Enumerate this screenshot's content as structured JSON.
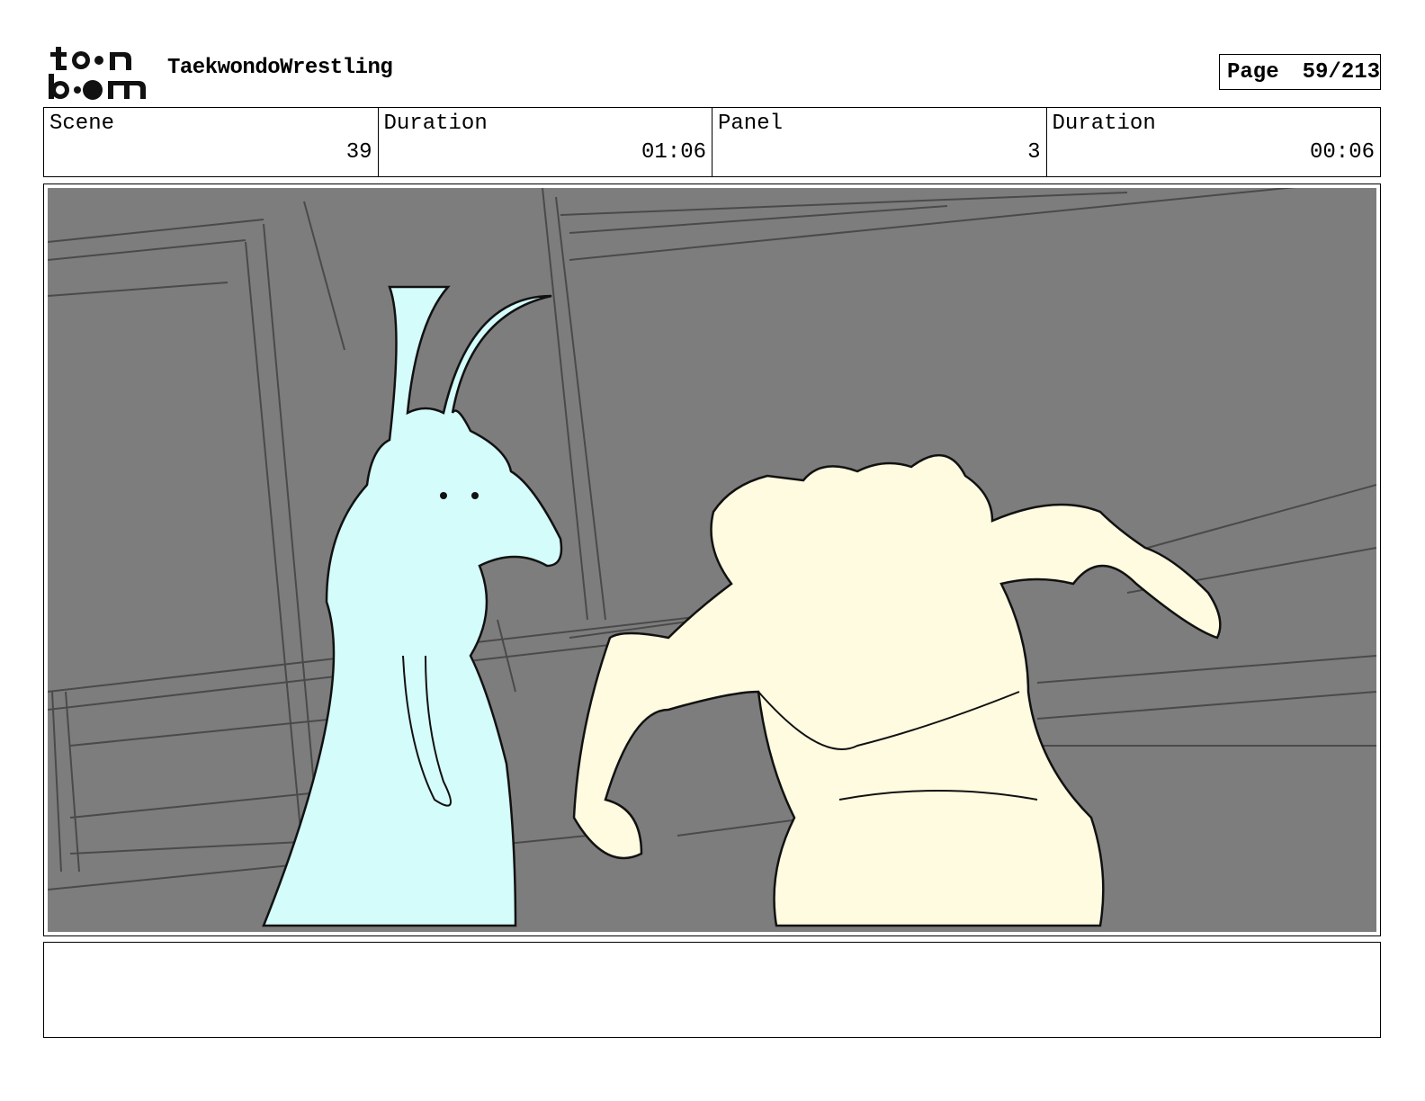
{
  "header": {
    "logo_top": "to●n",
    "logo_bottom": "b●●m",
    "project_title": "TaekwondoWrestling",
    "page_label": "Page",
    "page_number": "59/213"
  },
  "info": {
    "scene_label": "Scene",
    "scene_value": "39",
    "scene_duration_label": "Duration",
    "scene_duration_value": "01:06",
    "panel_label": "Panel",
    "panel_value": "3",
    "panel_duration_label": "Duration",
    "panel_duration_value": "00:06"
  },
  "panel": {
    "background_color": "#7d7d7d",
    "character_left_color": "#d4fcfb",
    "character_right_color": "#fffbe0"
  },
  "notes": {
    "text": ""
  }
}
